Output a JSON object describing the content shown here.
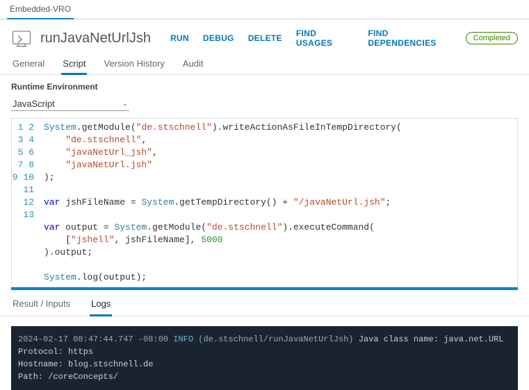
{
  "topTab": "Embedded-VRO",
  "action": {
    "title": "runJavaNetUrlJsh",
    "buttons": {
      "run": "RUN",
      "debug": "DEBUG",
      "delete": "DELETE",
      "findUsages": "FIND USAGES",
      "findDeps": "FIND DEPENDENCIES"
    },
    "status": "Completed"
  },
  "subTabs": {
    "general": "General",
    "script": "Script",
    "versionHistory": "Version History",
    "audit": "Audit"
  },
  "runtime": {
    "label": "Runtime Environment",
    "value": "JavaScript"
  },
  "lineNumbers": [
    "1",
    "2",
    "3",
    "4",
    "5",
    "6",
    "7",
    "8",
    "9",
    "10",
    "11",
    "12",
    "13"
  ],
  "code": {
    "l1": {
      "a": "System",
      "b": ".getModule(",
      "c": "\"de.stschnell\"",
      "d": ").writeActionAsFileInTempDirectory("
    },
    "l2": {
      "a": "    ",
      "b": "\"de.stschnell\"",
      "c": ","
    },
    "l3": {
      "a": "    ",
      "b": "\"javaNetUrl_jsh\"",
      "c": ","
    },
    "l4": {
      "a": "    ",
      "b": "\"javaNetUrl.jsh\""
    },
    "l5": {
      "a": ");"
    },
    "l6": "",
    "l7": {
      "a": "var",
      "b": " jshFileName = ",
      "c": "System",
      "d": ".getTempDirectory() + ",
      "e": "\"/javaNetUrl.jsh\"",
      "f": ";"
    },
    "l8": "",
    "l9": {
      "a": "var",
      "b": " output = ",
      "c": "System",
      "d": ".getModule(",
      "e": "\"de.stschnell\"",
      "f": ").executeCommand("
    },
    "l10": {
      "a": "    [",
      "b": "\"jshell\"",
      "c": ", jshFileName], ",
      "d": "5000"
    },
    "l11": {
      "a": ").output;"
    },
    "l12": "",
    "l13": {
      "a": "System",
      "b": ".log(output);"
    }
  },
  "resultTabs": {
    "resultInputs": "Result / Inputs",
    "logs": "Logs"
  },
  "console": {
    "ts": "2024-02-17 08:47:44.747 -08:00",
    "level": "INFO",
    "ctx": "(de.stschnell/runJavaNetUrlJsh)",
    "msg": "Java class name: java.net.URL",
    "line2": "Protocol: https",
    "line3": "Hostname: blog.stschnell.de",
    "line4": "Path: /coreConcepts/"
  }
}
